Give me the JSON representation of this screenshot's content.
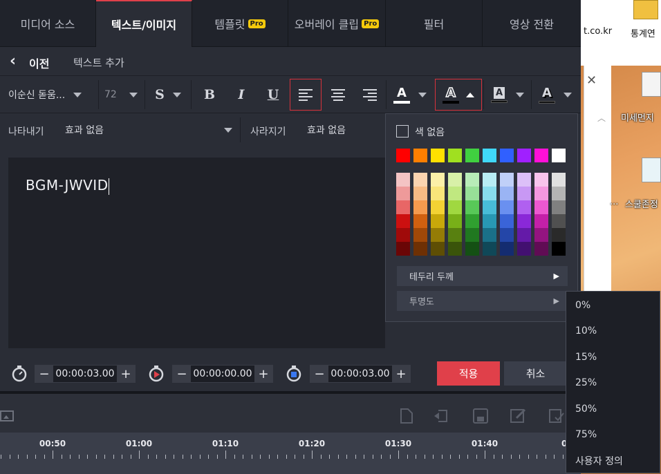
{
  "tabs": [
    {
      "label": "미디어 소스",
      "pro": false,
      "active": false
    },
    {
      "label": "텍스트/이미지",
      "pro": false,
      "active": true
    },
    {
      "label": "템플릿",
      "pro": true,
      "active": false
    },
    {
      "label": "오버레이 클립",
      "pro": true,
      "active": false
    },
    {
      "label": "필터",
      "pro": false,
      "active": false
    },
    {
      "label": "영상 전환",
      "pro": false,
      "active": false
    }
  ],
  "pro_badge": "Pro",
  "nav": {
    "back_label": "이전",
    "page_title": "텍스트 추가"
  },
  "toolbar": {
    "font_name": "이순신 돋움...",
    "font_size": "72",
    "style_s": "S",
    "bold": "B",
    "italic": "I",
    "underline": "U",
    "text_color_glyph": "A",
    "outline_glyph": "A",
    "bg_glyph": "A",
    "shadow_glyph": "A"
  },
  "effects": {
    "appear_label": "나타내기",
    "appear_value": "효과 없음",
    "disappear_label": "사라지기",
    "disappear_value": "효과 없음"
  },
  "editor": {
    "text": "BGM-JWVID"
  },
  "timing": [
    {
      "value": "00:00:03.00",
      "icon": "stopwatch-icon"
    },
    {
      "value": "00:00:00.00",
      "icon": "stopwatch-play-icon"
    },
    {
      "value": "00:00:03.00",
      "icon": "stopwatch-stop-icon"
    }
  ],
  "buttons": {
    "minus": "−",
    "plus": "+",
    "apply": "적용",
    "cancel": "취소"
  },
  "ruler": {
    "ticks": [
      "00:50",
      "01:00",
      "01:10",
      "01:20",
      "01:30",
      "01:40",
      "0"
    ]
  },
  "color_popup": {
    "no_color_label": "색 없음",
    "pure_colors": [
      "#ff0000",
      "#ff7f00",
      "#ffe000",
      "#a0e020",
      "#40d040",
      "#40d8f8",
      "#3060ff",
      "#a020ff",
      "#ff10d8",
      "#ffffff"
    ],
    "shade_columns": [
      [
        "#f4c4c4",
        "#ee9a9a",
        "#e86666",
        "#cc1010",
        "#a00a0a",
        "#6a0606"
      ],
      [
        "#fbd4b0",
        "#f8bb84",
        "#f59a4e",
        "#d06010",
        "#a04808",
        "#6e3004"
      ],
      [
        "#fbf0a8",
        "#f8e57a",
        "#f3d234",
        "#c8a80a",
        "#957c06",
        "#5e4e04"
      ],
      [
        "#d8f0a8",
        "#c0e880",
        "#a0d840",
        "#78b018",
        "#588010",
        "#3a540a"
      ],
      [
        "#b8ecb8",
        "#98e098",
        "#58c858",
        "#30a030",
        "#207820",
        "#145014"
      ],
      [
        "#b8ecf4",
        "#88dcec",
        "#48bcd8",
        "#2898b4",
        "#1a7088",
        "#104858"
      ],
      [
        "#c0d0f8",
        "#9ab4f4",
        "#6a90f0",
        "#3a64d8",
        "#2446a8",
        "#142c70"
      ],
      [
        "#dcc0f8",
        "#c898f4",
        "#b060f0",
        "#8a28d8",
        "#641aa8",
        "#421070"
      ],
      [
        "#f8c4ec",
        "#f498e0",
        "#ec58d0",
        "#c420a8",
        "#941480",
        "#600c54"
      ],
      [
        "#e0e0e0",
        "#b4b4b4",
        "#808080",
        "#505050",
        "#2a2a2a",
        "#000000"
      ]
    ],
    "border_thickness_label": "테두리 두께",
    "opacity_label": "투명도"
  },
  "opacity_menu": [
    "0%",
    "10%",
    "15%",
    "25%",
    "50%",
    "75%",
    "사용자 정의"
  ],
  "desktop": {
    "partial_text_1": "t.co.kr",
    "icon_label_1": "통계연",
    "icon_label_2": "미세먼지",
    "icon_label_3": "스쿨존정",
    "dots": "..."
  },
  "colors": {
    "accent_red": "#e0404a",
    "apply_red": "#e0404a",
    "pro_yellow": "#f3c90c"
  }
}
